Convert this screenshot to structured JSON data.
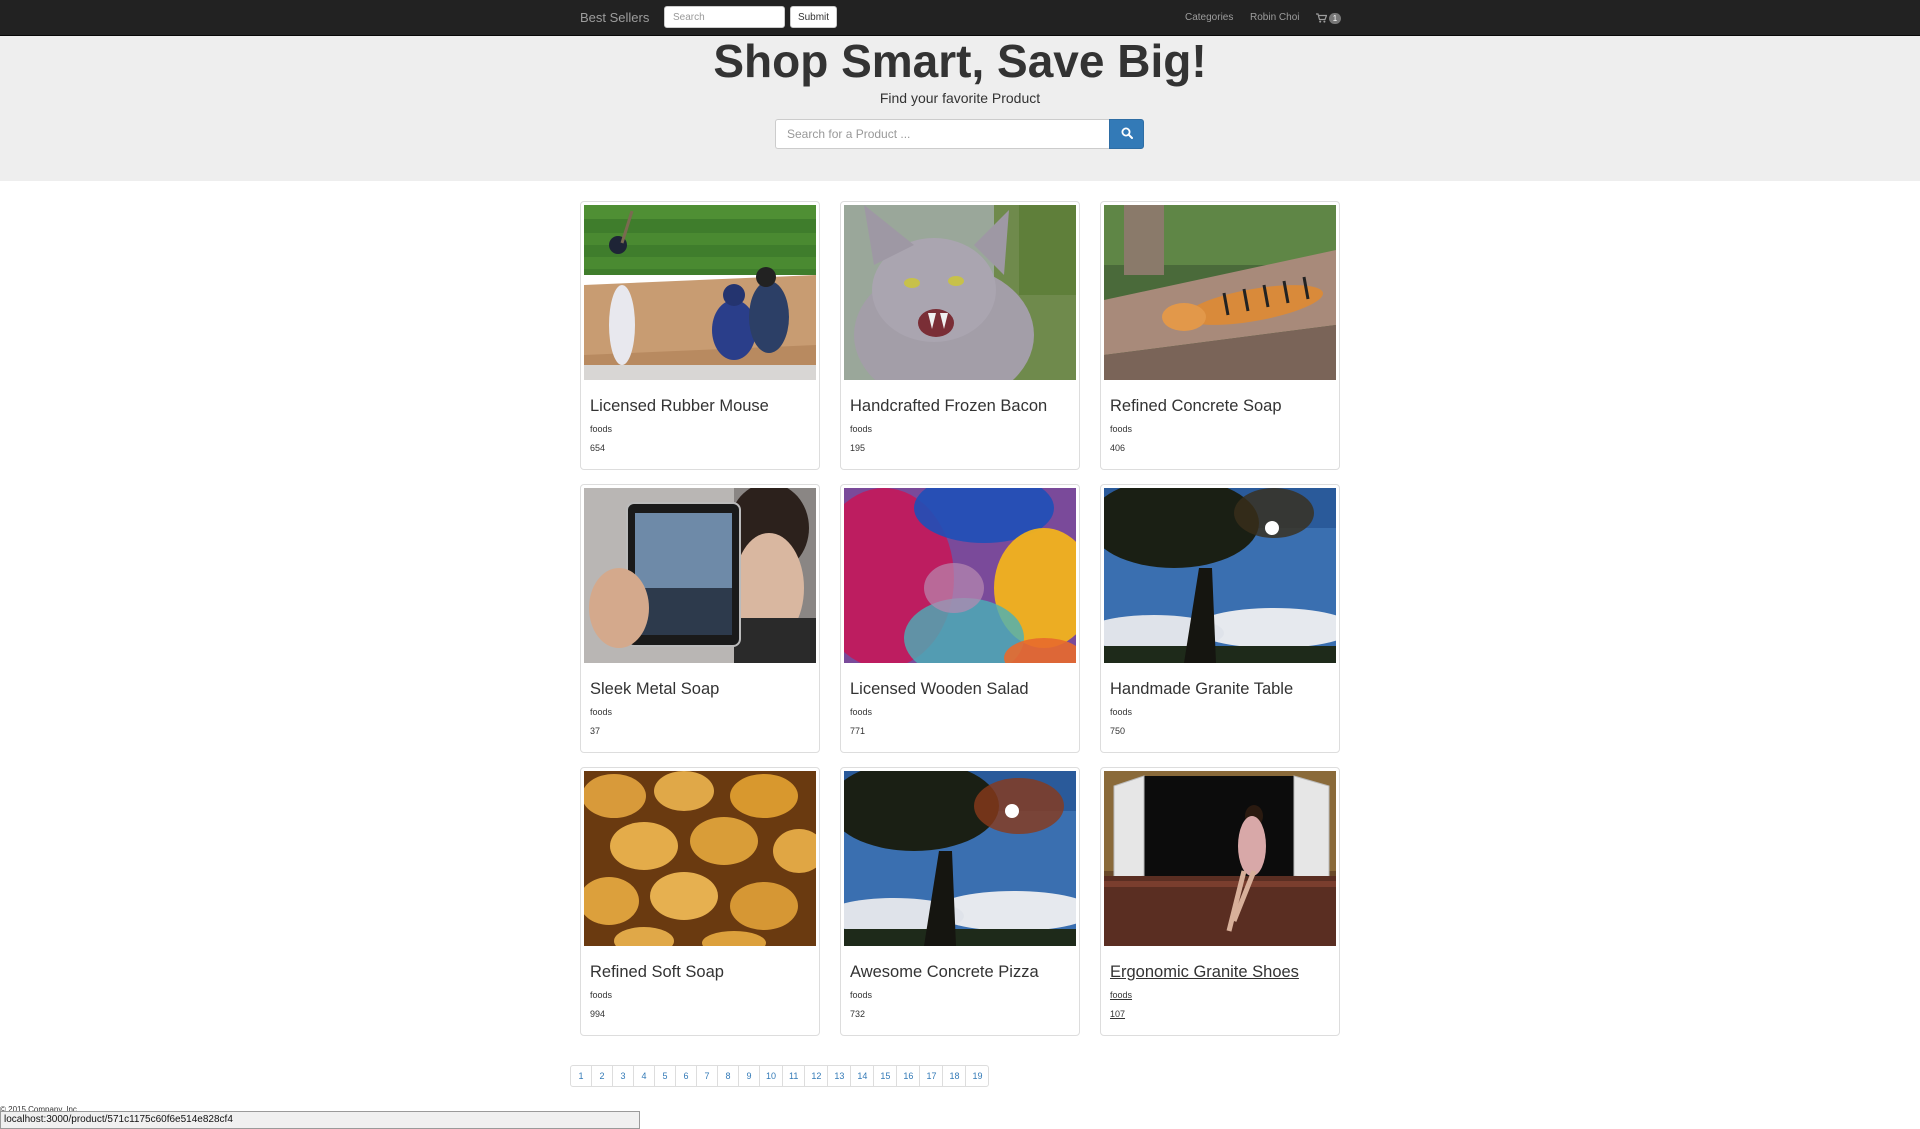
{
  "navbar": {
    "brand": "Best Sellers",
    "search_placeholder": "Search",
    "submit_label": "Submit",
    "categories_label": "Categories",
    "user_name": "Robin Choi",
    "cart_count": "1"
  },
  "hero": {
    "title": "Shop Smart, Save Big!",
    "subtitle": "Find your favorite Product",
    "search_placeholder": "Search for a Product ..."
  },
  "products": [
    {
      "name": "Licensed Rubber Mouse",
      "category": "foods",
      "price": "654",
      "image": "baseball-photo"
    },
    {
      "name": "Handcrafted Frozen Bacon",
      "category": "foods",
      "price": "195",
      "image": "cat-photo"
    },
    {
      "name": "Refined Concrete Soap",
      "category": "foods",
      "price": "406",
      "image": "tiger-photo"
    },
    {
      "name": "Sleek Metal Soap",
      "category": "foods",
      "price": "37",
      "image": "tablet-photo"
    },
    {
      "name": "Licensed Wooden Salad",
      "category": "foods",
      "price": "771",
      "image": "abstract-photo"
    },
    {
      "name": "Handmade Granite Table",
      "category": "foods",
      "price": "750",
      "image": "tree-photo"
    },
    {
      "name": "Refined Soft Soap",
      "category": "foods",
      "price": "994",
      "image": "bread-photo"
    },
    {
      "name": "Awesome Concrete Pizza",
      "category": "foods",
      "price": "732",
      "image": "tree-photo"
    },
    {
      "name": "Ergonomic Granite Shoes",
      "category": "foods",
      "price": "107",
      "image": "window-photo"
    }
  ],
  "pagination": {
    "pages": [
      "1",
      "2",
      "3",
      "4",
      "5",
      "6",
      "7",
      "8",
      "9",
      "10",
      "11",
      "12",
      "13",
      "14",
      "15",
      "16",
      "17",
      "18",
      "19"
    ]
  },
  "footer": {
    "copyright": "© 2015 Company, Inc."
  },
  "statusbar": {
    "url": "localhost:3000/product/571c1175c60f6e514e828cf4"
  },
  "colors": {
    "navbar_bg": "#222222",
    "jumbotron_bg": "#eeeeee",
    "primary": "#337ab7",
    "link": "#337ab7"
  }
}
